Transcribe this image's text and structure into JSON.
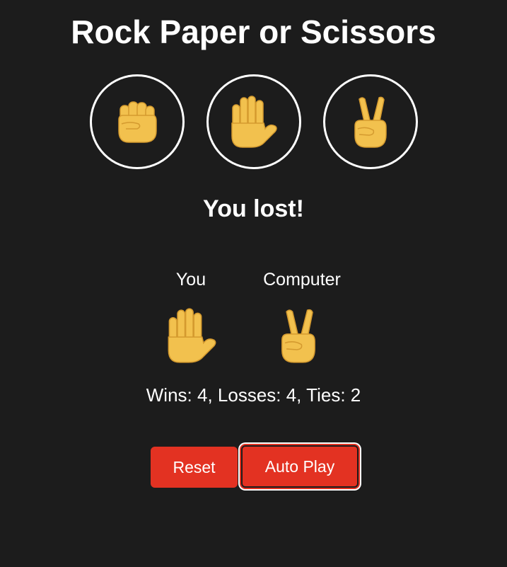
{
  "title": "Rock Paper or Scissors",
  "moves": [
    {
      "name": "rock",
      "icon": "raised-fist-icon"
    },
    {
      "name": "paper",
      "icon": "raised-hand-icon"
    },
    {
      "name": "scissors",
      "icon": "victory-hand-icon"
    }
  ],
  "result": "You lost!",
  "labels": {
    "you": "You",
    "computer": "Computer"
  },
  "picks": {
    "you": "raised-hand-icon",
    "computer": "victory-hand-icon"
  },
  "score": "Wins: 4, Losses: 4, Ties: 2",
  "buttons": {
    "reset": "Reset",
    "auto_play": "Auto Play"
  },
  "colors": {
    "background": "#1c1c1c",
    "accent": "#e33222",
    "emoji_skin": "#f2c14e"
  }
}
